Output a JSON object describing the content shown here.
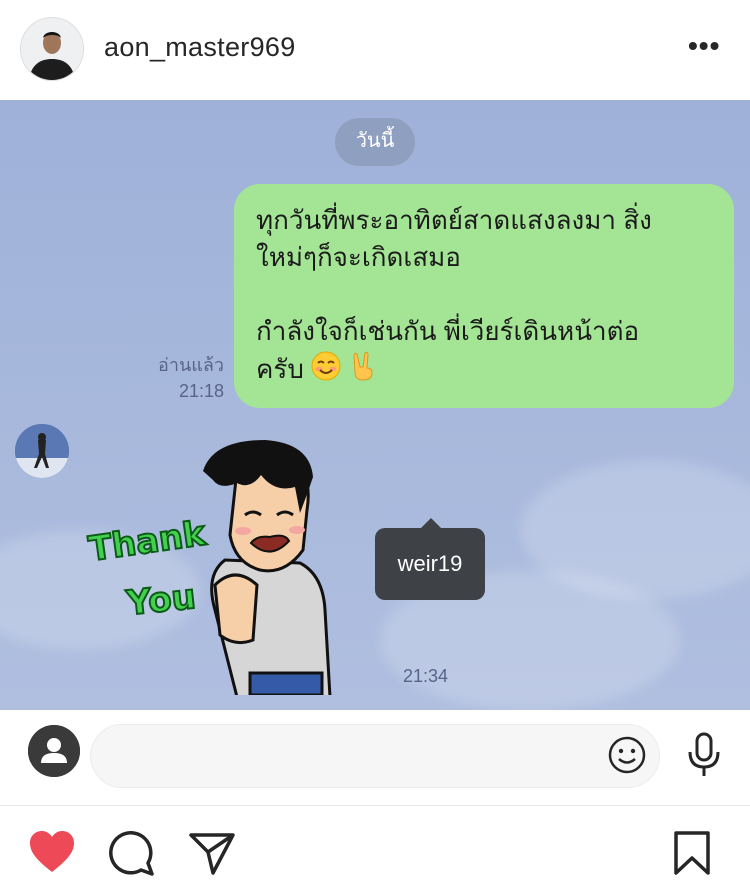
{
  "header": {
    "username": "aon_master969",
    "more_label": "•••"
  },
  "chat": {
    "date_label": "วันนี้",
    "message": {
      "line1": "ทุกวันที่พระอาทิตย์สาดแสงลงมา สิ่ง",
      "line2": "ใหม่ๆก็จะเกิดเสมอ",
      "line3": "กำลังใจก็เช่นกัน พี่เวียร์เดินหน้าต่อ",
      "line4": "ครับ",
      "emojis": [
        "smiling-face",
        "victory-hand"
      ],
      "read_label": "อ่านแล้ว",
      "time": "21:18"
    },
    "sticker": {
      "text_line1": "Thank",
      "text_line2": "You",
      "time": "21:34"
    },
    "tag_tooltip": "weir19"
  },
  "composer": {
    "placeholder": ""
  },
  "colors": {
    "bubble_green": "#a3e495",
    "chat_bg": "#a7b8dc",
    "like_red": "#ed4956",
    "tooltip_bg": "#3e4145"
  }
}
